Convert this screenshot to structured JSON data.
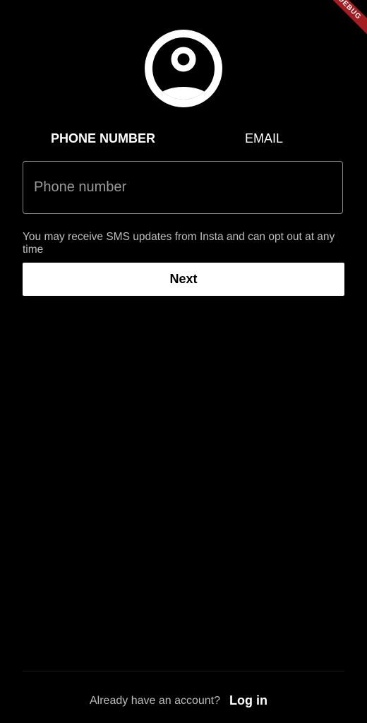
{
  "debug_banner": {
    "label": "DEBUG"
  },
  "avatar": {
    "icon": "account-circle-icon"
  },
  "tabs": [
    {
      "label": "PHONE NUMBER",
      "selected": true
    },
    {
      "label": "EMAIL",
      "selected": false
    }
  ],
  "phone_input": {
    "value": "",
    "placeholder": "Phone number"
  },
  "sms_note": "You may receive SMS updates from Insta and can opt out at any time",
  "next_button": {
    "label": "Next"
  },
  "footer": {
    "prompt": "Already have an account?",
    "login_label": "Log in"
  },
  "colors": {
    "background": "#000000",
    "foreground": "#ffffff",
    "muted_text": "#bdbdbd",
    "debug_ribbon": "#a31d21"
  }
}
